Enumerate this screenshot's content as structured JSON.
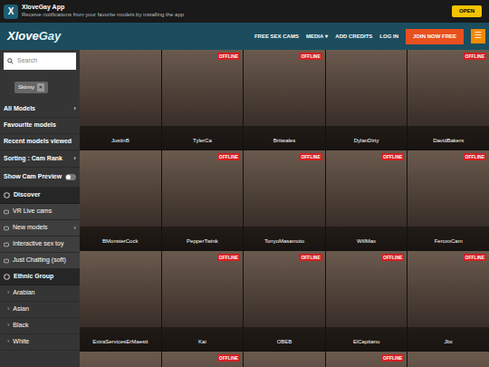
{
  "app_banner": {
    "icon": "X",
    "title": "XloveGay App",
    "subtitle": "Receive notifications from your favorite models by installing the app",
    "button": "OPEN"
  },
  "header": {
    "logo_first": "Xlove",
    "logo_second": "Gay",
    "nav": [
      {
        "label": "FREE SEX CAMS",
        "caret": ""
      },
      {
        "label": "MEDIA",
        "caret": "▾"
      },
      {
        "label": "ADD CREDITS",
        "caret": ""
      },
      {
        "label": "LOG IN",
        "caret": ""
      }
    ],
    "join_button": "JOIN NOW FREE",
    "menu_button": "☰"
  },
  "sidebar": {
    "search": {
      "placeholder": "Search"
    },
    "filter_chip": {
      "label": "Skinny",
      "remove": "×"
    },
    "items": [
      {
        "kind": "link",
        "label": "All Models",
        "arrow": "›"
      },
      {
        "kind": "link",
        "label": "Favourite models",
        "arrow": ""
      },
      {
        "kind": "link",
        "label": "Recent models viewed",
        "arrow": ""
      },
      {
        "kind": "link",
        "label": "Sorting : Cam Rank",
        "arrow": "›"
      },
      {
        "kind": "toggle",
        "label": "Show Cam Preview",
        "on": false
      },
      {
        "kind": "section",
        "label": "Discover"
      },
      {
        "kind": "sub",
        "label": "VR Live cams",
        "arrow": ""
      },
      {
        "kind": "sub",
        "label": "New models",
        "arrow": "›"
      },
      {
        "kind": "sub",
        "label": "Interactive sex toy",
        "arrow": ""
      },
      {
        "kind": "sub",
        "label": "Just Chatting (soft)",
        "arrow": ""
      },
      {
        "kind": "section",
        "label": "Ethnic Group"
      },
      {
        "kind": "option",
        "label": "Arabian",
        "bullet": "›"
      },
      {
        "kind": "option",
        "label": "Asian",
        "bullet": "›"
      },
      {
        "kind": "option",
        "label": "Black",
        "bullet": "›"
      },
      {
        "kind": "option",
        "label": "White",
        "bullet": "›"
      }
    ]
  },
  "offline_label": "OFFLINE",
  "models": [
    {
      "name": "JustinB",
      "offline": false
    },
    {
      "name": "TylerCa",
      "offline": true
    },
    {
      "name": "Britwales",
      "offline": true
    },
    {
      "name": "DylanDirty",
      "offline": false
    },
    {
      "name": "DavidBakers",
      "offline": true
    },
    {
      "name": "BMonsterCock",
      "offline": false
    },
    {
      "name": "PepperTwink",
      "offline": true
    },
    {
      "name": "TonyoMasamoto",
      "offline": true
    },
    {
      "name": "WillMax",
      "offline": true
    },
    {
      "name": "FeroxxCam",
      "offline": true
    },
    {
      "name": "ExtraServicesErMaestt",
      "offline": false
    },
    {
      "name": "Kai",
      "offline": true
    },
    {
      "name": "OBEB",
      "offline": true
    },
    {
      "name": "ElCapitano",
      "offline": true
    },
    {
      "name": "Jbx",
      "offline": true
    },
    {
      "name": "",
      "offline": false
    },
    {
      "name": "",
      "offline": true
    },
    {
      "name": "",
      "offline": false
    },
    {
      "name": "",
      "offline": true
    },
    {
      "name": "",
      "offline": false
    }
  ]
}
